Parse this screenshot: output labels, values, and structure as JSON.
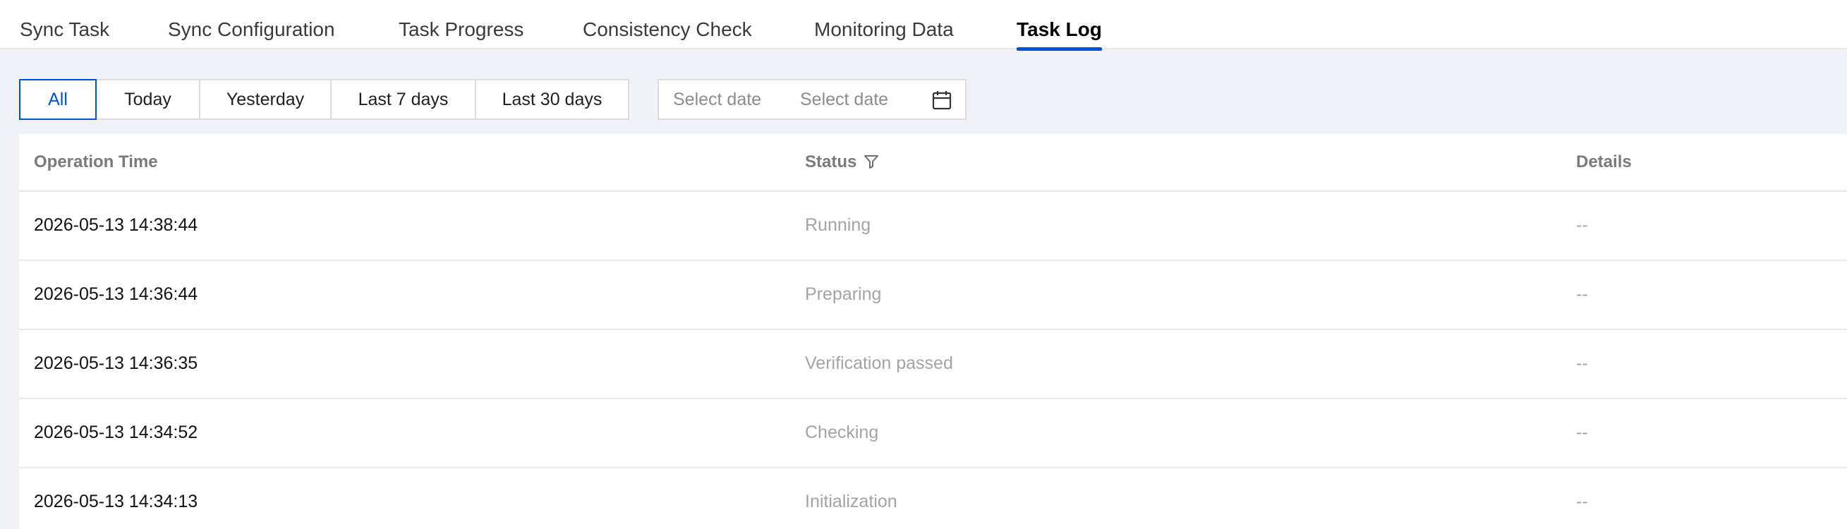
{
  "tabs": [
    {
      "label": "Sync Task"
    },
    {
      "label": "Sync Configuration"
    },
    {
      "label": "Task Progress"
    },
    {
      "label": "Consistency Check"
    },
    {
      "label": "Monitoring Data"
    },
    {
      "label": "Task Log",
      "active": true
    }
  ],
  "filters": {
    "ranges": [
      {
        "label": "All",
        "selected": true
      },
      {
        "label": "Today"
      },
      {
        "label": "Yesterday"
      },
      {
        "label": "Last 7 days"
      },
      {
        "label": "Last 30 days"
      }
    ],
    "start_date_placeholder": "Select date",
    "end_date_placeholder": "Select date"
  },
  "table": {
    "columns": {
      "operation_time": "Operation Time",
      "status": "Status",
      "details": "Details"
    },
    "rows": [
      {
        "time": "2026-05-13 14:38:44",
        "status": "Running",
        "details": "--"
      },
      {
        "time": "2026-05-13 14:36:44",
        "status": "Preparing",
        "details": "--"
      },
      {
        "time": "2026-05-13 14:36:35",
        "status": "Verification passed",
        "details": "--"
      },
      {
        "time": "2026-05-13 14:34:52",
        "status": "Checking",
        "details": "--"
      },
      {
        "time": "2026-05-13 14:34:13",
        "status": "Initialization",
        "details": "--"
      }
    ]
  },
  "colors": {
    "accent": "#0052d9",
    "page_background": "#f0f2f7",
    "muted_text": "#a3a3a3"
  },
  "icons": {
    "date_picker": "calendar-icon",
    "status_filter": "filter-icon"
  }
}
